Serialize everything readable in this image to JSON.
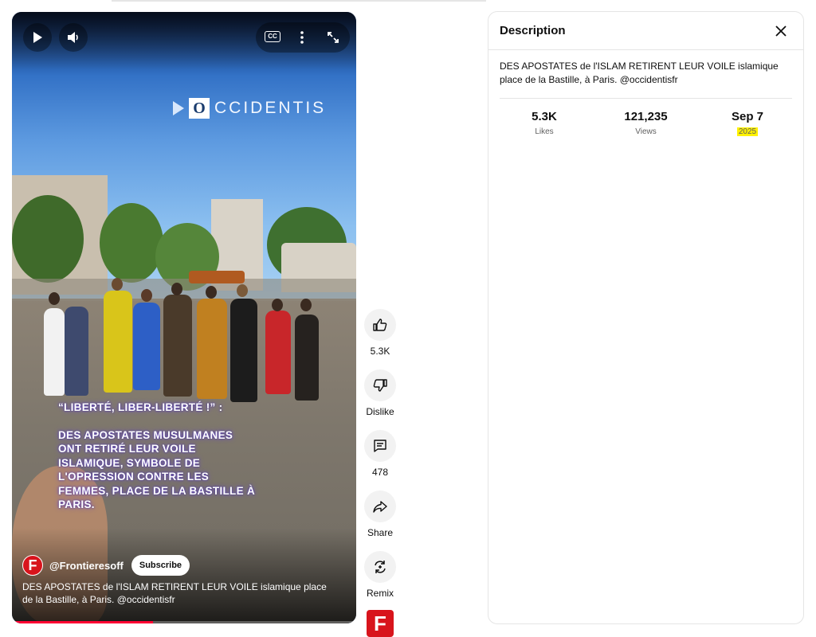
{
  "player": {
    "watermark": "CCIDENTIS",
    "watermark_initial": "O",
    "overlay_quote": "“LIBERTÉ, LIBER-LIBERTÉ !” :",
    "overlay_body": "DES APOSTATES MUSULMANES ONT RETIRÉ LEUR VOILE ISLAMIQUE, SYMBOLE DE L'OPRESSION CONTRE LES FEMMES, PLACE DE LA BASTILLE À PARIS.",
    "channel_name": "@Frontieresoff",
    "channel_initial": "F",
    "subscribe_label": "Subscribe",
    "title": "DES APOSTATES de l'ISLAM RETIRENT LEUR VOILE islamique place de la Bastille, à Paris. @occidentisfr",
    "progress": 0.41,
    "cc_label": "CC"
  },
  "actions": {
    "like_label": "5.3K",
    "dislike_label": "Dislike",
    "comments_label": "478",
    "share_label": "Share",
    "remix_label": "Remix",
    "channel_logo": "F"
  },
  "description_panel": {
    "title": "Description",
    "text": "DES APOSTATES de l'ISLAM RETIRENT LEUR VOILE islamique place de la Bastille, à Paris. @occidentisfr",
    "stats": {
      "likes_value": "5.3K",
      "likes_label": "Likes",
      "views_value": "121,235",
      "views_label": "Views",
      "date_value": "Sep 7",
      "date_year": "2025"
    }
  },
  "colors": {
    "accent_red": "#ff0033",
    "brand_red": "#d8141c",
    "highlight": "#fff200"
  }
}
